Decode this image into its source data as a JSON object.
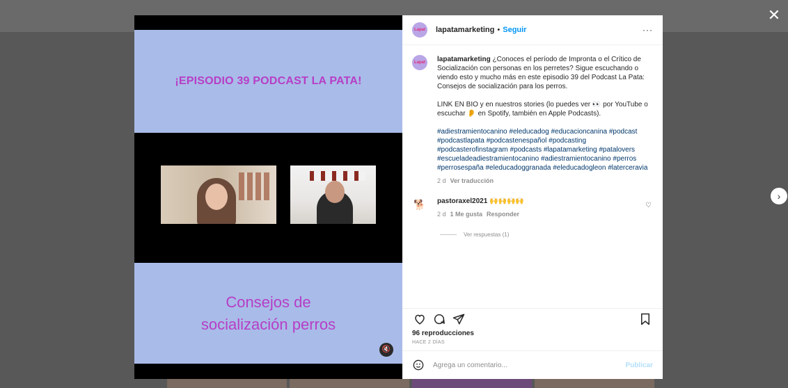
{
  "overlay": {
    "close_label": "✕",
    "next_label": "›"
  },
  "post": {
    "username": "lapatamarketing",
    "separator": "•",
    "follow_label": "Seguir",
    "more_label": "···",
    "avatar_text": "Lapat",
    "media": {
      "episode_title": "¡EPISODIO 39 PODCAST LA PATA!",
      "subtitle_line1": "Consejos de",
      "subtitle_line2": "socialización perros",
      "mute_icon": "🔇"
    },
    "caption": {
      "text": "¿Conoces el período de Impronta o el Crítico de Socialización con personas en los perretes? Sigue escuchando o viendo esto y mucho más en este episodio 39 del Podcast La Pata: Consejos de socialización para los perros.\n\nLINK EN BIO y en nuestros stories (lo puedes ver 👀 por YouTube o escuchar 👂 en Spotify, también en Apple Podcasts).",
      "hashtags": "#adiestramientocanino #eleducadog #educacioncanina #podcast #podcastlapata #podcastenespañol #podcasting #podcasterofinstagram #podcasts #lapatamarketing #patalovers #escueladeadiestramientocanino #adiestramientocanino #perros #perrosespaña #eleducadoggranada #eleducadogleon #laterceravia",
      "time": "2 d",
      "translate_label": "Ver traducción"
    },
    "comment": {
      "username": "pastoraxel2021",
      "text": "🙌🙌🙌🙌",
      "time": "2 d",
      "likes_label": "1 Me gusta",
      "reply_label": "Responder",
      "view_replies_label": "Ver respuestas (1)"
    },
    "views": "96 reproducciones",
    "posted_ago": "HACE 2 DÍAS",
    "comment_placeholder": "Agrega un comentario...",
    "publish_label": "Publicar"
  }
}
